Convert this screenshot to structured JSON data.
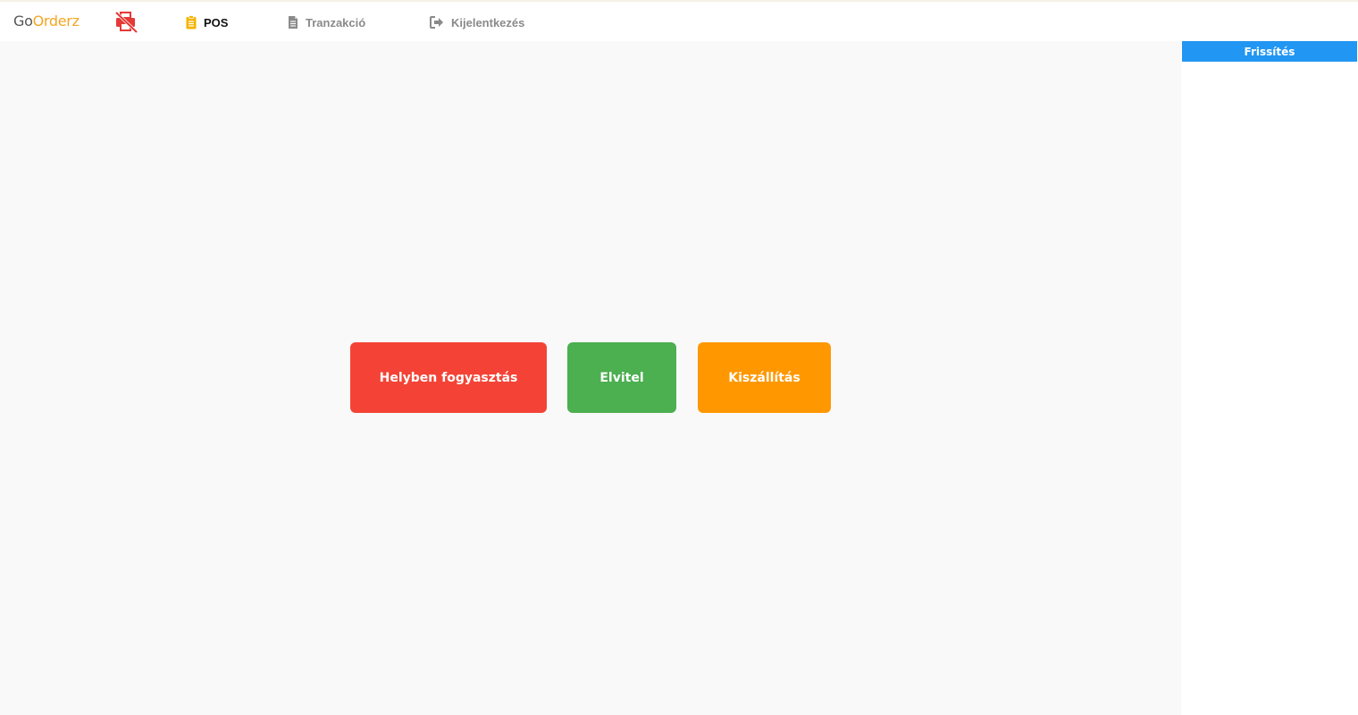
{
  "brand": {
    "part1": "Go",
    "part2": "Orderz"
  },
  "nav": {
    "pos_label": "POS",
    "tranzakcio_label": "Tranzakció",
    "logout_label": "Kijelentkezés"
  },
  "sidebar": {
    "refresh_label": "Frissítés"
  },
  "order_types": {
    "dine_in": "Helyben fogyasztás",
    "takeaway": "Elvitel",
    "delivery": "Kiszállítás"
  },
  "icons": {
    "printer": "printer-disabled-icon",
    "pos": "clipboard-icon",
    "tranzakcio": "document-icon",
    "logout": "sign-out-icon"
  },
  "colors": {
    "brand_accent": "#f5a623",
    "printer_status": "#e53935",
    "refresh": "#2196f3",
    "dine_in": "#f44336",
    "takeaway": "#4caf50",
    "delivery": "#ff9800"
  }
}
